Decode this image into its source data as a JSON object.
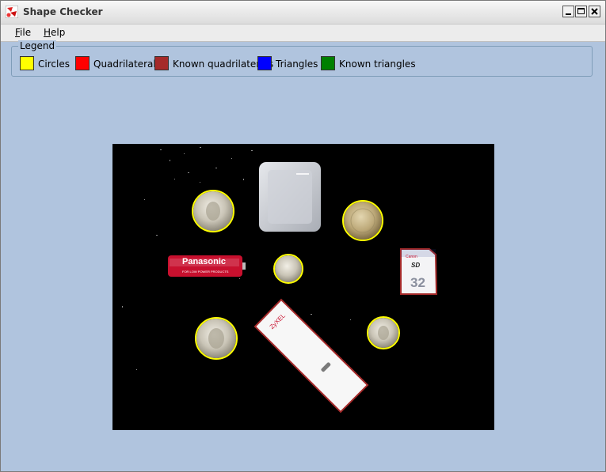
{
  "window": {
    "title": "Shape Checker",
    "app_icon": "shape-checker-icon"
  },
  "title_buttons": [
    "minimize-icon",
    "maximize-icon",
    "close-icon"
  ],
  "menu": {
    "items": [
      {
        "accel": "F",
        "rest": "ile"
      },
      {
        "accel": "H",
        "rest": "elp"
      }
    ]
  },
  "legend": {
    "title": "Legend",
    "items": [
      {
        "label": "Circles",
        "color": "#ffff00"
      },
      {
        "label": "Quadrilaterals",
        "color": "#ff0000"
      },
      {
        "label": "Known quadrilaterals",
        "color": "#a52a2a"
      },
      {
        "label": "Triangles",
        "color": "#0000ff"
      },
      {
        "label": "Known triangles",
        "color": "#008000"
      }
    ]
  },
  "image": {
    "background": "#000000",
    "objects": [
      {
        "name": "coin",
        "detected": "circle",
        "outline": "#ffff00"
      },
      {
        "name": "memory-card-case",
        "detected": "none"
      },
      {
        "name": "coin",
        "detected": "circle",
        "outline": "#ffff00"
      },
      {
        "name": "battery",
        "detected": "none",
        "text": "Panasonic",
        "subtext": "FOR LOW POWER PRODUCTS"
      },
      {
        "name": "coin",
        "detected": "circle",
        "outline": "#ffff00"
      },
      {
        "name": "sd-card",
        "detected": "known-quadrilateral",
        "outline": "#a52a2a",
        "text_top": "Canon",
        "text_mid": "SD",
        "text_big": "32"
      },
      {
        "name": "coin",
        "detected": "circle",
        "outline": "#ffff00"
      },
      {
        "name": "usb-stick",
        "detected": "known-quadrilateral",
        "outline": "#a52a2a",
        "text": "ZyXEL"
      },
      {
        "name": "coin",
        "detected": "circle",
        "outline": "#ffff00"
      }
    ]
  }
}
